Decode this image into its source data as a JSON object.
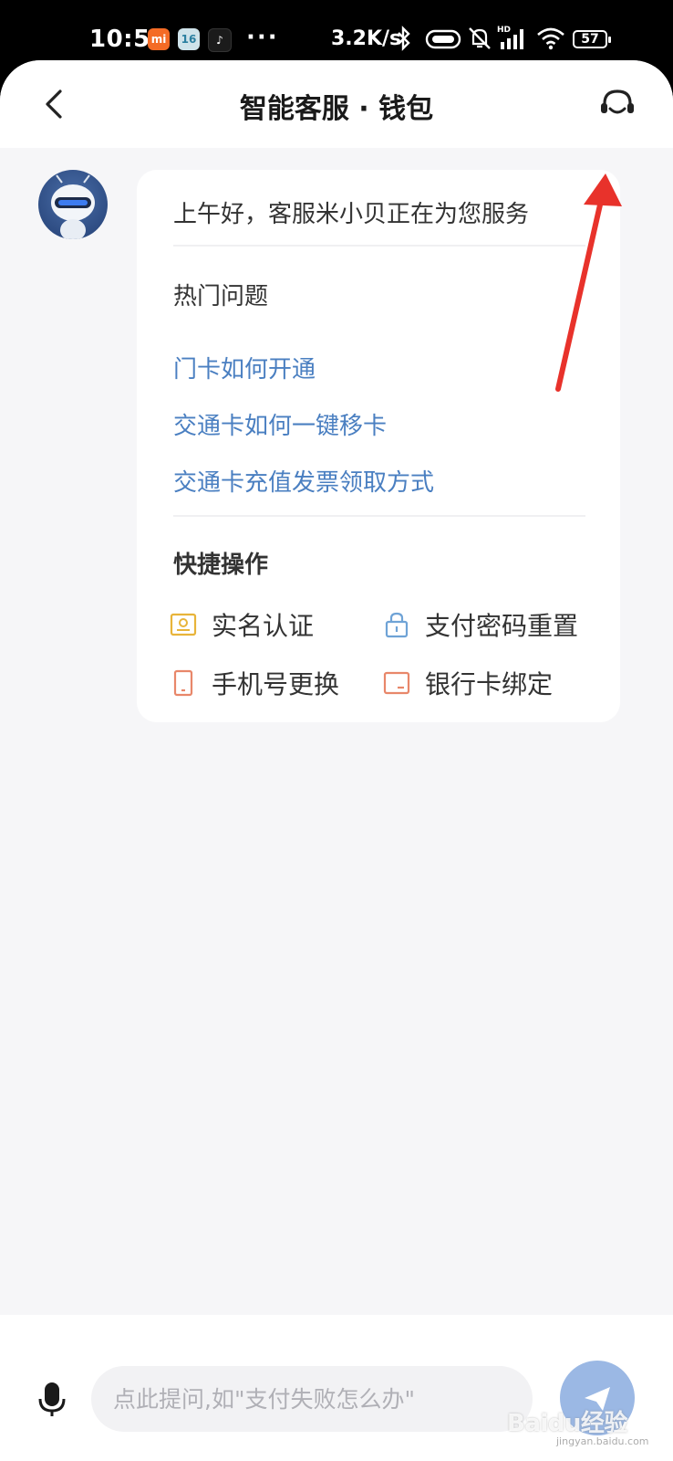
{
  "status_bar": {
    "time": "10:50",
    "app_icons": [
      "mi",
      "16",
      "tiktok"
    ],
    "app_icon_texts": {
      "mi": "mi",
      "num": "16",
      "tt": "♪"
    },
    "more": "···",
    "net_speed": "3.2K/s",
    "battery": "57"
  },
  "header": {
    "title": "智能客服 · 钱包",
    "back_icon": "chevron-left-icon",
    "agent_icon": "headset-icon"
  },
  "chat": {
    "greeting": "上午好，客服米小贝正在为您服务",
    "hot_title": "热门问题",
    "faqs": [
      "门卡如何开通",
      "交通卡如何一键移卡",
      "交通卡充值发票领取方式"
    ],
    "quick_title": "快捷操作",
    "actions": [
      {
        "label": "实名认证",
        "icon": "id-card-icon",
        "color": "#e8b43a"
      },
      {
        "label": "支付密码重置",
        "icon": "lock-icon",
        "color": "#6fa3d6"
      },
      {
        "label": "手机号更换",
        "icon": "phone-icon",
        "color": "#e8876a"
      },
      {
        "label": "银行卡绑定",
        "icon": "bank-card-icon",
        "color": "#e8876a"
      }
    ]
  },
  "input": {
    "placeholder": "点此提问,如\"支付失败怎么办\""
  },
  "watermark": {
    "text": "Baidu经验",
    "sub": "jingyan.baidu.com"
  },
  "colors": {
    "link": "#4a7fc1",
    "annotation_arrow": "#e8322b",
    "send_button": "#9bb8e4"
  }
}
